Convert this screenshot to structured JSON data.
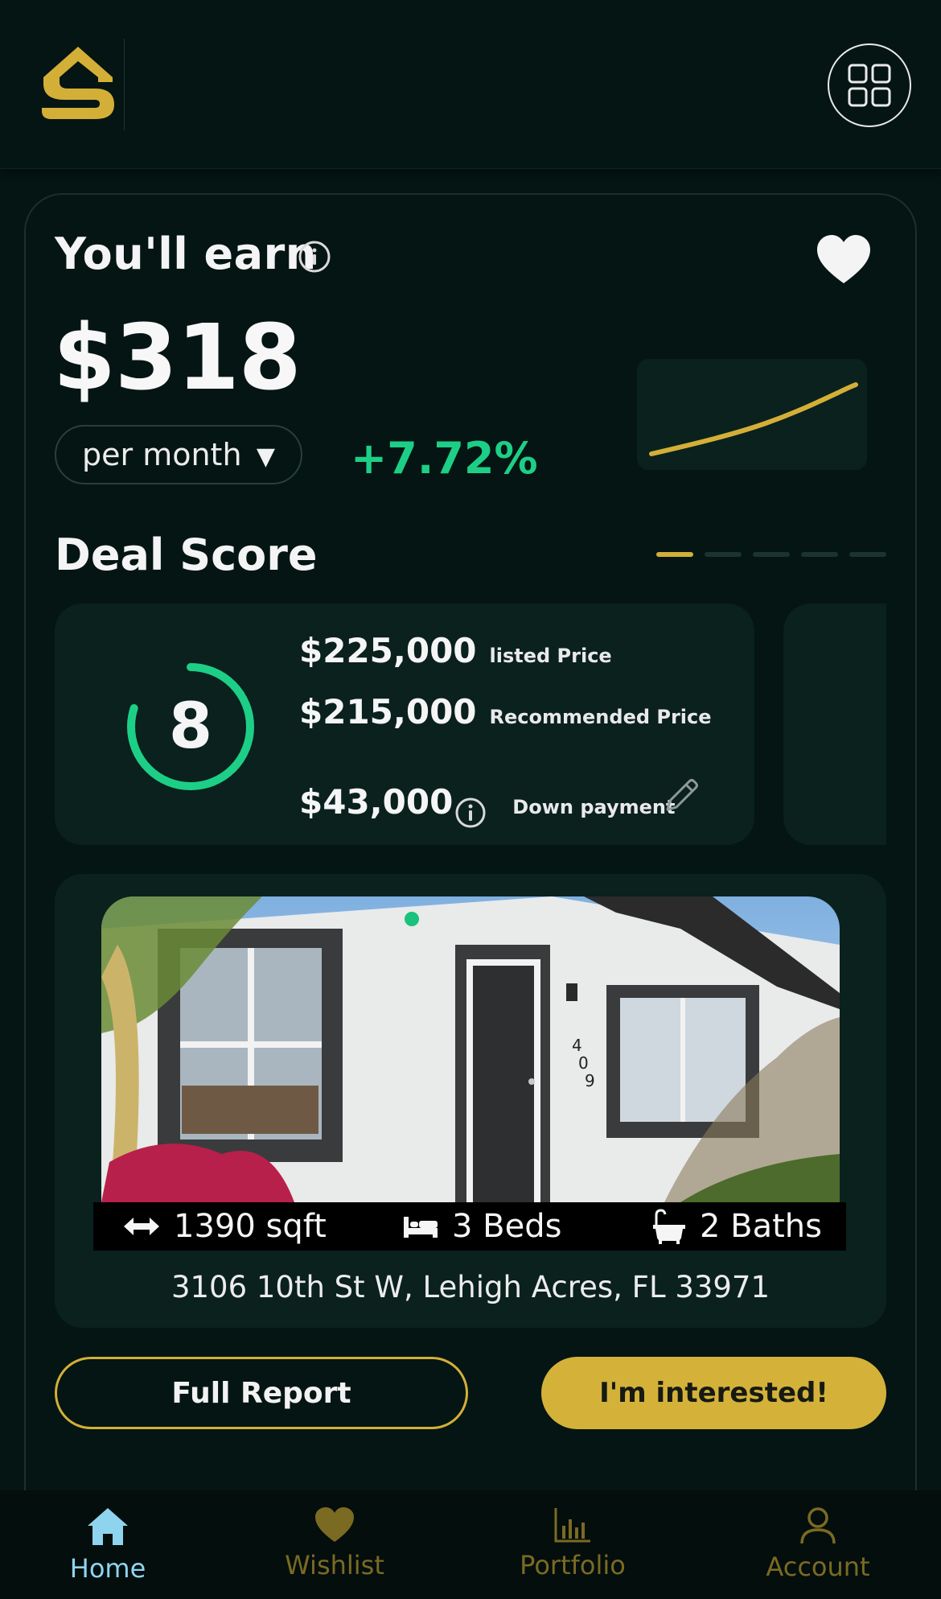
{
  "header": {
    "logo_icon": "house-s-logo-icon",
    "menu_icon": "grid-icon"
  },
  "earnings": {
    "title": "You'll earn",
    "amount": "$318",
    "period": "per month",
    "change": "+7.72%",
    "trend_color": "#d4af37",
    "change_color": "#1dcf86"
  },
  "deal_score": {
    "title": "Deal Score",
    "score": "8",
    "score_fraction": 0.8,
    "carousel_active_index": 0,
    "carousel_count": 5,
    "listed_price": "$225,000",
    "listed_label": "listed Price",
    "recommended_price": "$215,000",
    "recommended_label": "Recommended Price",
    "down_payment": "$43,000",
    "down_payment_label": "Down payment"
  },
  "property": {
    "sqft": "1390 sqft",
    "beds": "3 Beds",
    "baths": "2 Baths",
    "address": "3106 10th St W, Lehigh Acres, FL 33971",
    "house_number": "409"
  },
  "actions": {
    "full_report": "Full Report",
    "interested": "I'm interested!"
  },
  "nav": {
    "items": [
      {
        "label": "Home",
        "icon": "home-icon"
      },
      {
        "label": "Wishlist",
        "icon": "heart-icon"
      },
      {
        "label": "Portfolio",
        "icon": "bar-chart-icon"
      },
      {
        "label": "Account",
        "icon": "user-icon"
      }
    ]
  },
  "colors": {
    "background": "#041513",
    "card": "#0a211e",
    "accent_gold": "#d4af37",
    "accent_green": "#1dcf86",
    "nav_active": "#8fd4ef"
  }
}
